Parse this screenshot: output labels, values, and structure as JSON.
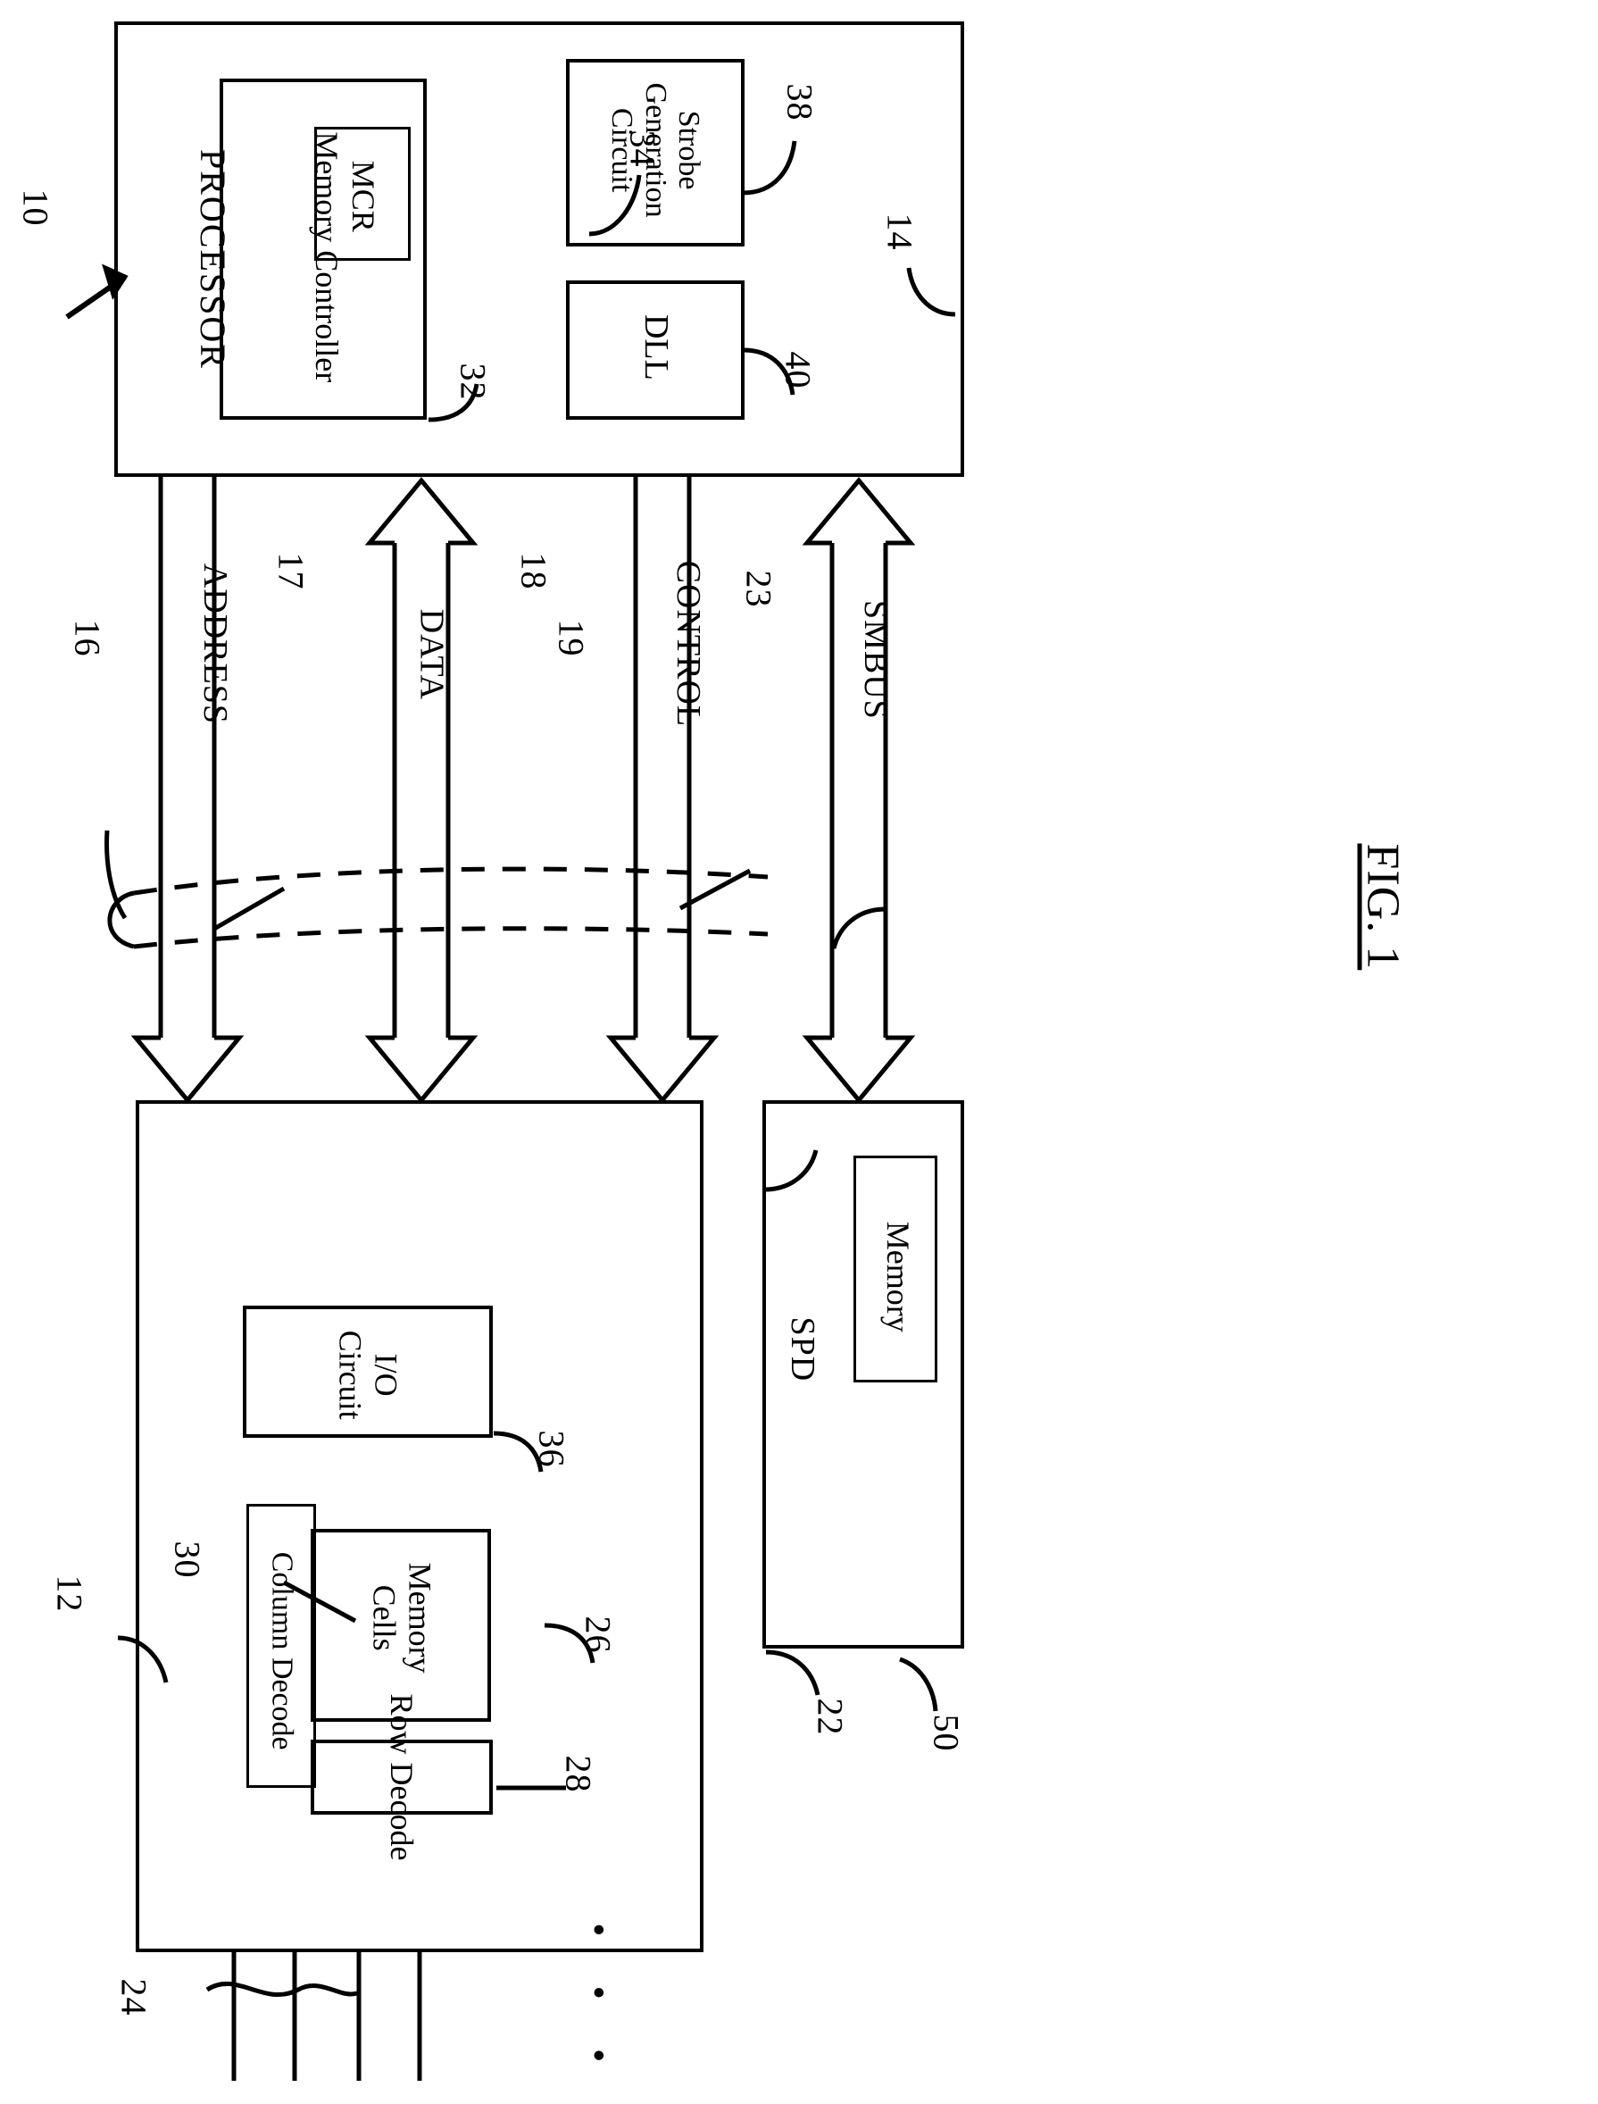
{
  "figure": {
    "label": "FIG. 1",
    "system_ref": "10"
  },
  "processor": {
    "title": "PROCESSOR",
    "ref": "14",
    "blocks": [
      {
        "name": "memory-controller",
        "label": "Memory Controller",
        "ref": "32"
      },
      {
        "name": "mcr-register",
        "label": "MCR",
        "ref": "34"
      },
      {
        "name": "strobe-generation-circuit",
        "label": "Strobe\nGeneration\nCircuit",
        "ref": "38"
      },
      {
        "name": "dll",
        "label": "DLL",
        "ref": "40"
      }
    ]
  },
  "buses": {
    "group_ref": "16",
    "lines": [
      {
        "name": "address-bus",
        "label": "ADDRESS",
        "ref": "17",
        "direction": "down"
      },
      {
        "name": "data-bus",
        "label": "DATA",
        "ref": "18",
        "direction": "both"
      },
      {
        "name": "control-bus",
        "label": "CONTROL",
        "ref": "19",
        "direction": "down"
      },
      {
        "name": "smbus",
        "label": "SMBUS",
        "ref": "23",
        "direction": "both"
      }
    ]
  },
  "memory_device": {
    "ref": "12",
    "pins_ref": "24",
    "blocks": [
      {
        "name": "io-circuit",
        "label": "I/O\nCircuit",
        "ref": "36"
      },
      {
        "name": "column-decode",
        "label": "Column Decode",
        "ref": "30"
      },
      {
        "name": "memory-cells",
        "label": "Memory\nCells",
        "ref": "26"
      },
      {
        "name": "row-decode",
        "label": "Row Decode",
        "ref": "28"
      }
    ],
    "ellipsis": "• • •"
  },
  "spd": {
    "label": "SPD",
    "ref": "22",
    "memory": {
      "label": "Memory",
      "ref": "50"
    }
  },
  "colors": {
    "ink": "#000000",
    "paper": "#ffffff"
  }
}
